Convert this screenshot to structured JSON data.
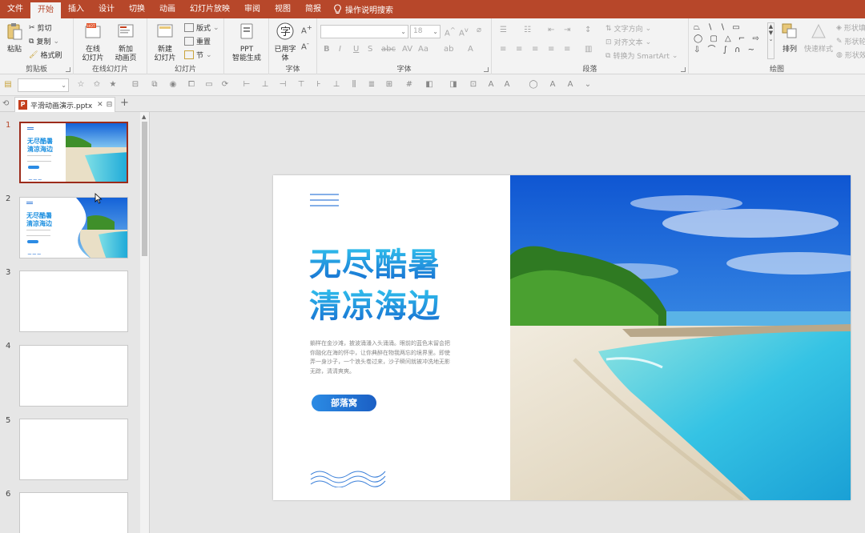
{
  "menu": {
    "items": [
      "文件",
      "开始",
      "插入",
      "设计",
      "切换",
      "动画",
      "幻灯片放映",
      "审阅",
      "视图",
      "简报"
    ],
    "active": "开始",
    "tell_me": "操作说明搜索"
  },
  "ribbon": {
    "clipboard": {
      "paste": "粘贴",
      "cut": "剪切",
      "copy": "复制",
      "format_painter": "格式刷",
      "label": "剪贴板"
    },
    "online_slides": {
      "online": "在线",
      "online2": "幻灯片",
      "add": "新加",
      "add2": "动画页",
      "label": "在线幻灯片"
    },
    "slides": {
      "new": "新建",
      "new2": "幻灯片",
      "layout": "版式",
      "reset": "重置",
      "section": "节",
      "label": "幻灯片"
    },
    "ppt_ai": {
      "line1": "PPT",
      "line2": "智能生成"
    },
    "font": {
      "used": "已用字",
      "used2": "体",
      "font_size": "18",
      "label_left": "字体",
      "label": "字体"
    },
    "paragraph": {
      "text_direction": "文字方向",
      "align_text": "对齐文本",
      "convert_smartart": "转换为 SmartArt",
      "label": "段落"
    },
    "drawing": {
      "arrange": "排列",
      "quick_styles": "快速样式",
      "shape_fill": "形状填",
      "shape_outline": "形状轮",
      "shape_effects": "形状效",
      "label": "绘图"
    }
  },
  "tab": {
    "filename": "平滑动画演示.pptx"
  },
  "slides": {
    "numbers": [
      "1",
      "2",
      "3",
      "4",
      "5",
      "6"
    ],
    "selected": 1
  },
  "slide": {
    "title_line1": "无尽酷暑",
    "title_line2": "清凉海边",
    "body": "躺样在金沙滩，披波涌潘入头涌涌。眼前的蓝色末留会把你融化在海的怀中，让你典醉在物我两忘的境界里。即使弄一身沙子，一个浪头卷过来，沙子瞬间就被冲洗地无影无踪，清清爽爽。",
    "button": "部落窝",
    "thumb_title_line1": "无尽酷暑",
    "thumb_title_line2": "清凉海边"
  },
  "colors": {
    "brand": "#b7472a",
    "title_blue": "#1c8fe0",
    "button_blue": "#2b8be4",
    "selected_border": "#9c2b1a"
  }
}
